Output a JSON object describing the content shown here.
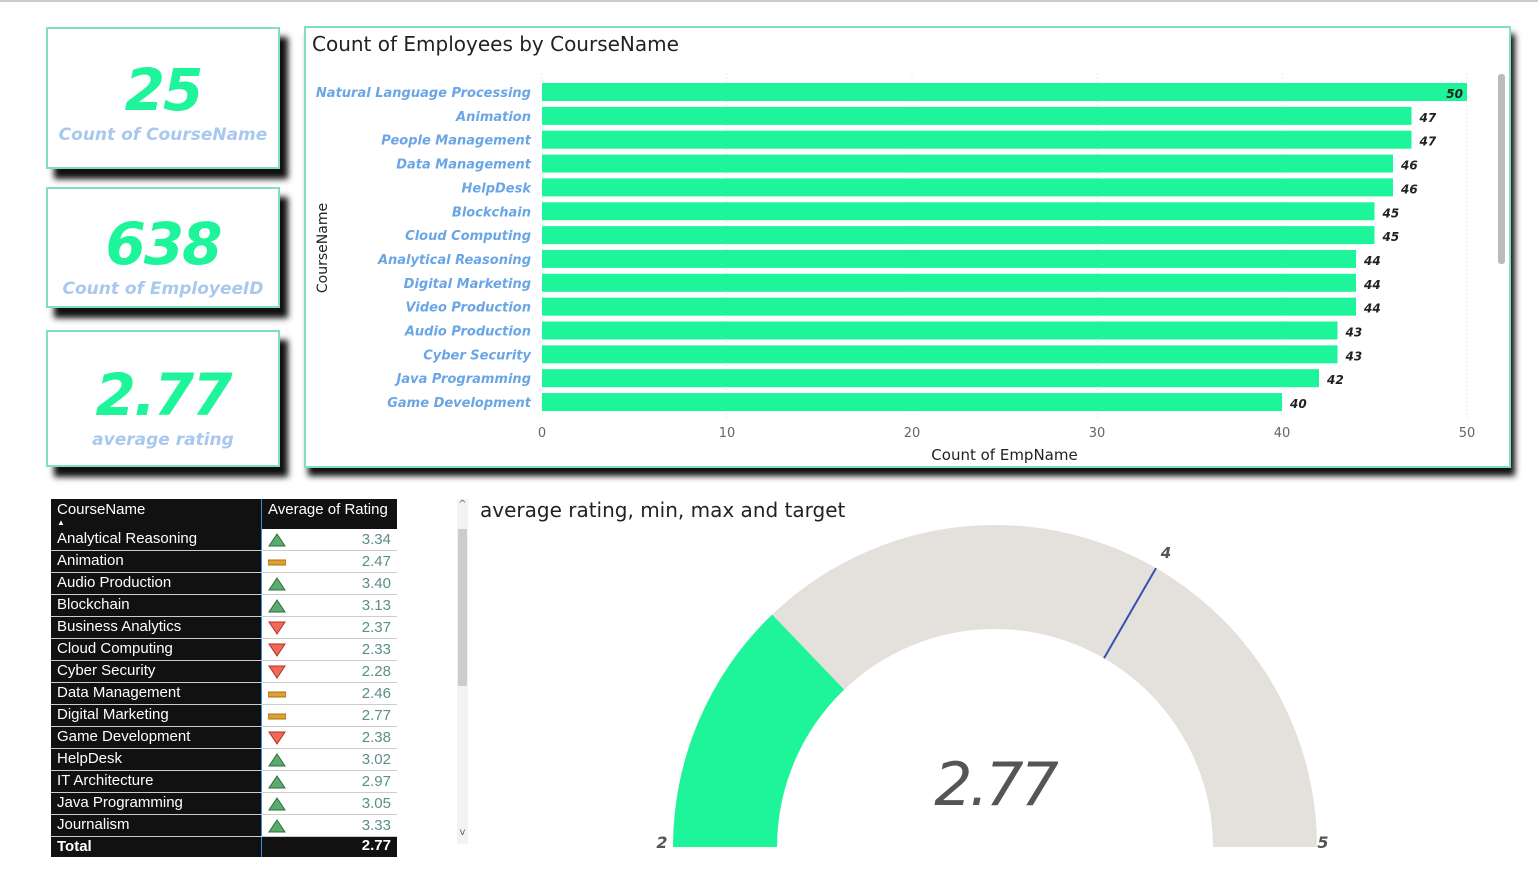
{
  "cards": [
    {
      "value": "25",
      "label": "Count of CourseName"
    },
    {
      "value": "638",
      "label": "Count of EmployeeID"
    },
    {
      "value": "2.77",
      "label": "average rating"
    }
  ],
  "chart_data": [
    {
      "type": "bar",
      "orientation": "horizontal",
      "title": "Count of Employees by CourseName",
      "xlabel": "Count of EmpName",
      "ylabel": "CourseName",
      "xlim": [
        0,
        50
      ],
      "xticks": [
        0,
        10,
        20,
        30,
        40,
        50
      ],
      "bar_color": "#1ef59a",
      "categories": [
        "Natural Language Processing",
        "Animation",
        "People Management",
        "Data Management",
        "HelpDesk",
        "Blockchain",
        "Cloud Computing",
        "Analytical Reasoning",
        "Digital Marketing",
        "Video Production",
        "Audio Production",
        "Cyber Security",
        "Java Programming",
        "Game Development"
      ],
      "values": [
        50,
        47,
        47,
        46,
        46,
        45,
        45,
        44,
        44,
        44,
        43,
        43,
        42,
        40
      ]
    },
    {
      "type": "gauge",
      "title": "average rating, min, max and target",
      "min": 2,
      "max": 5,
      "value": 2.77,
      "value_label": "2.77",
      "target": 4,
      "fill_color": "#1ef59a",
      "track_color": "#e4e0db",
      "target_color": "#3a4fb0"
    }
  ],
  "table": {
    "headers": [
      "CourseName",
      "Average of Rating"
    ],
    "rows": [
      [
        "Analytical Reasoning",
        "up",
        "3.34"
      ],
      [
        "Animation",
        "flat",
        "2.47"
      ],
      [
        "Audio Production",
        "up",
        "3.40"
      ],
      [
        "Blockchain",
        "up",
        "3.13"
      ],
      [
        "Business Analytics",
        "down",
        "2.37"
      ],
      [
        "Cloud Computing",
        "down",
        "2.33"
      ],
      [
        "Cyber Security",
        "down",
        "2.28"
      ],
      [
        "Data Management",
        "flat",
        "2.46"
      ],
      [
        "Digital Marketing",
        "flat",
        "2.77"
      ],
      [
        "Game Development",
        "down",
        "2.38"
      ],
      [
        "HelpDesk",
        "up",
        "3.02"
      ],
      [
        "IT Architecture",
        "up",
        "2.97"
      ],
      [
        "Java Programming",
        "up",
        "3.05"
      ],
      [
        "Journalism",
        "up",
        "3.33"
      ]
    ],
    "total_label": "Total",
    "total_value": "2.77"
  }
}
